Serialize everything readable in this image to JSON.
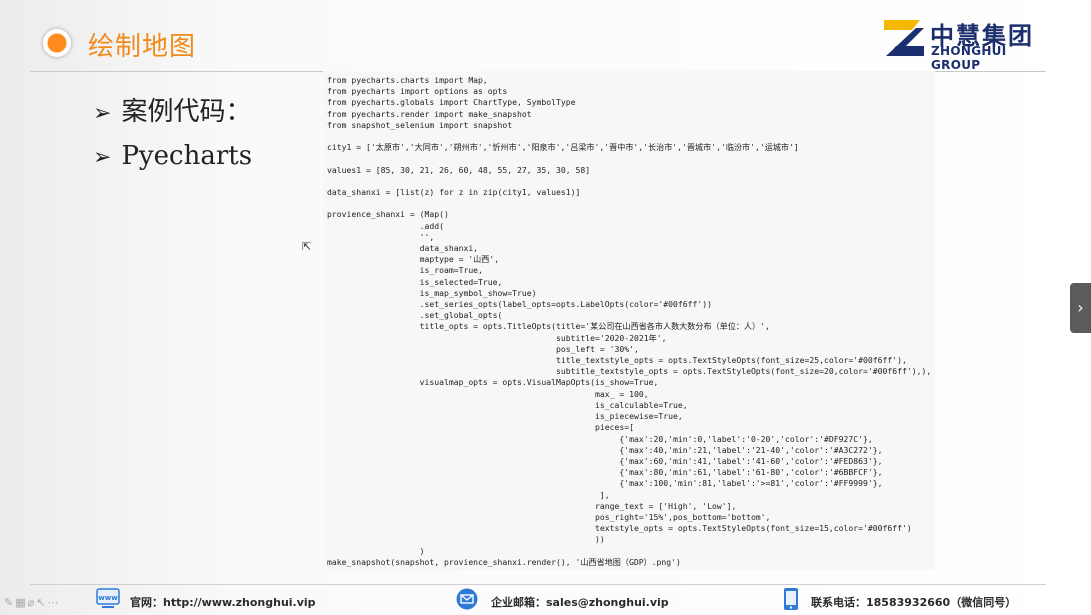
{
  "header": {
    "title": "绘制地图"
  },
  "logo": {
    "cn": "中慧集团",
    "en": "ZHONGHUI GROUP"
  },
  "bullets": [
    {
      "text": "案例代码："
    },
    {
      "text": "Pyecharts"
    }
  ],
  "code": {
    "lines": [
      "from pyecharts.charts import Map,",
      "from pyecharts import options as opts",
      "from pyecharts.globals import ChartType, SymbolType",
      "from pyecharts.render import make_snapshot",
      "from snapshot_selenium import snapshot",
      "",
      "city1 = ['太原市','大同市','朔州市','忻州市','阳泉市','吕梁市','晋中市','长治市','晋城市','临汾市','运城市']",
      "",
      "values1 = [85, 30, 21, 26, 60, 48, 55, 27, 35, 30, 58]",
      "",
      "data_shanxi = [list(z) for z in zip(city1, values1)]",
      "",
      "provience_shanxi = (Map()",
      "                   .add(",
      "                   '',",
      "                   data_shanxi,",
      "                   maptype = '山西',",
      "                   is_roam=True,",
      "                   is_selected=True,",
      "                   is_map_symbol_show=True)",
      "                   .set_series_opts(label_opts=opts.LabelOpts(color='#00f6ff'))",
      "                   .set_global_opts(",
      "                   title_opts = opts.TitleOpts(title='某公司在山西省各市人数大数分布（单位：人）',",
      "                                               subtitle='2020-2021年',",
      "                                               pos_left = '30%',",
      "                                               title_textstyle_opts = opts.TextStyleOpts(font_size=25,color='#00f6ff'),",
      "                                               subtitle_textstyle_opts = opts.TextStyleOpts(font_size=20,color='#00f6ff'),),",
      "                   visualmap_opts = opts.VisualMapOpts(is_show=True,",
      "                                                       max_ = 100,",
      "                                                       is_calculable=True,",
      "                                                       is_piecewise=True,",
      "                                                       pieces=[",
      "                                                            {'max':20,'min':0,'label':'0-20','color':'#DF927C'},",
      "                                                            {'max':40,'min':21,'label':'21-40','color':'#A3C272'},",
      "                                                            {'max':60,'min':41,'label':'41-60','color':'#FED863'},",
      "                                                            {'max':80,'min':61,'label':'61-80','color':'#6BBFCF'},",
      "                                                            {'max':100,'min':81,'label':'>=81','color':'#FF9999'},",
      "                                                        ],",
      "                                                       range_text = ['High', 'Low'],",
      "                                                       pos_right='15%',pos_bottom='bottom',",
      "                                                       textstyle_opts = opts.TextStyleOpts(font_size=15,color='#00f6ff')",
      "                                                       ))",
      "                   )",
      "make_snapshot(snapshot, provience_shanxi.render(), '山西省地图（GDP）.png')"
    ]
  },
  "footer": {
    "website": "官网：http://www.zhonghui.vip",
    "email": "企业邮箱：sales@zhonghui.vip",
    "phone": "联系电话：18583932660（微信同号）"
  },
  "colors": {
    "accent": "#f08a18",
    "brand": "#1b2f6e",
    "logo_yellow": "#f5b800"
  }
}
